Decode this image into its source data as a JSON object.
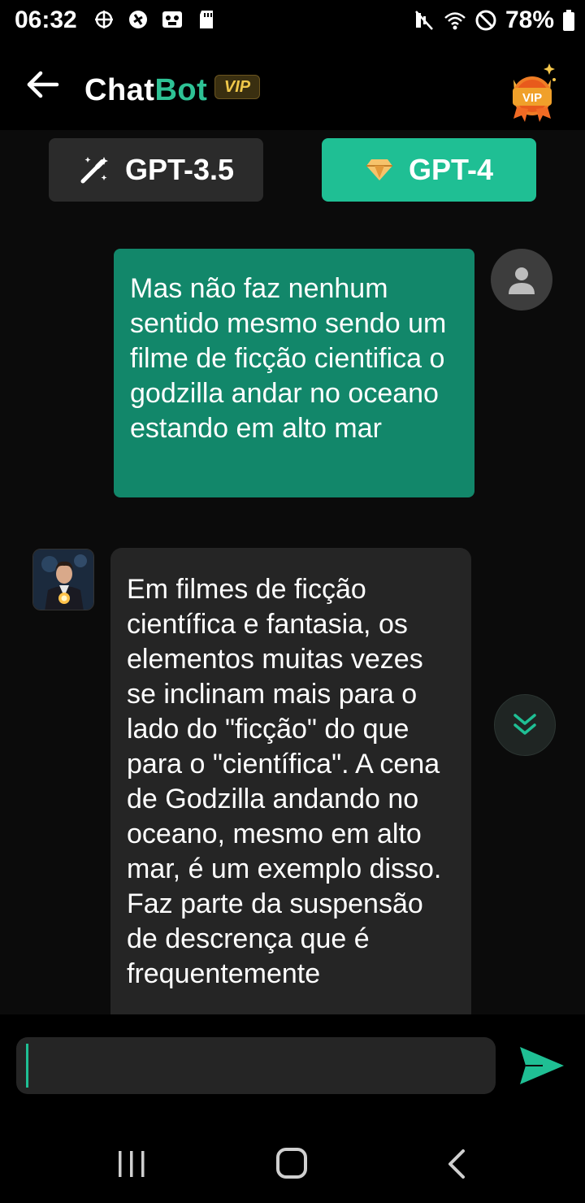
{
  "status_bar": {
    "time": "06:32",
    "battery": "78%",
    "icons_left": [
      "vpn-key-icon",
      "location-off-icon",
      "voicemail-icon",
      "sd-card-icon"
    ],
    "icons_right": [
      "mute-icon",
      "wifi-icon",
      "do-not-disturb-icon",
      "battery-icon"
    ]
  },
  "header": {
    "title_part1": "Chat",
    "title_part2": "Bot",
    "vip_tag": "VIP",
    "vip_badge": "VIP",
    "accent_color": "#2ec295"
  },
  "model_toggle": {
    "gpt35_label": "GPT-3.5",
    "gpt4_label": "GPT-4",
    "selected": "GPT-4",
    "selected_color": "#1fbf94"
  },
  "messages": {
    "user_text": "Mas não faz nenhum sentido mesmo sendo um filme de ficção cientifica o godzilla andar no oceano estando em alto mar",
    "bot_text": "Em filmes de ficção científica e fantasia, os elementos muitas vezes se inclinam mais para o lado do \"ficção\" do que para o \"científica\". A cena de Godzilla andando no oceano, mesmo em alto mar, é um exemplo disso. Faz parte da suspensão de descrença que é frequentemente",
    "user_bubble_color": "#12876a",
    "bot_bubble_color": "#252525"
  },
  "composer": {
    "input_value": "",
    "send_icon": "send-icon"
  },
  "nav": {
    "recents_icon": "recents-icon",
    "home_icon": "home-icon",
    "back_icon": "back-icon"
  }
}
